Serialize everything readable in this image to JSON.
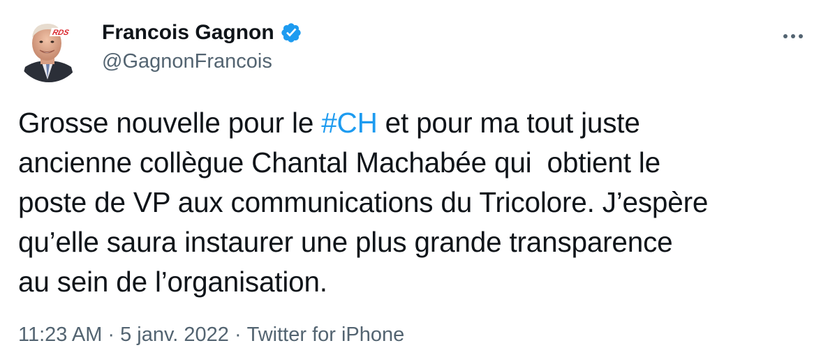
{
  "author": {
    "display_name": "Francois Gagnon",
    "handle": "@GagnonFrancois",
    "verified": true,
    "avatar_icon": "profile-photo-icon",
    "avatar_logo_text": "RDS"
  },
  "tweet": {
    "text_line1_before": "Grosse nouvelle pour le ",
    "hashtag": "#CH",
    "text_line1_after": " et pour ma tout juste",
    "text_line2": "ancienne collègue Chantal Machabée qui  obtient le",
    "text_line3": "poste de VP aux communications du Tricolore. J’espère",
    "text_line4": "qu’elle saura instaurer une plus grande transparence",
    "text_line5": "au sein de l’organisation."
  },
  "meta": {
    "time": "11:23 AM",
    "separator1": "·",
    "date": "5 janv. 2022",
    "separator2": "·",
    "source": "Twitter for iPhone"
  },
  "colors": {
    "text": "#0f1419",
    "secondary": "#536471",
    "accent": "#1d9bf0"
  },
  "icons": {
    "verified": "verified-badge-icon",
    "more": "more-options-icon"
  }
}
